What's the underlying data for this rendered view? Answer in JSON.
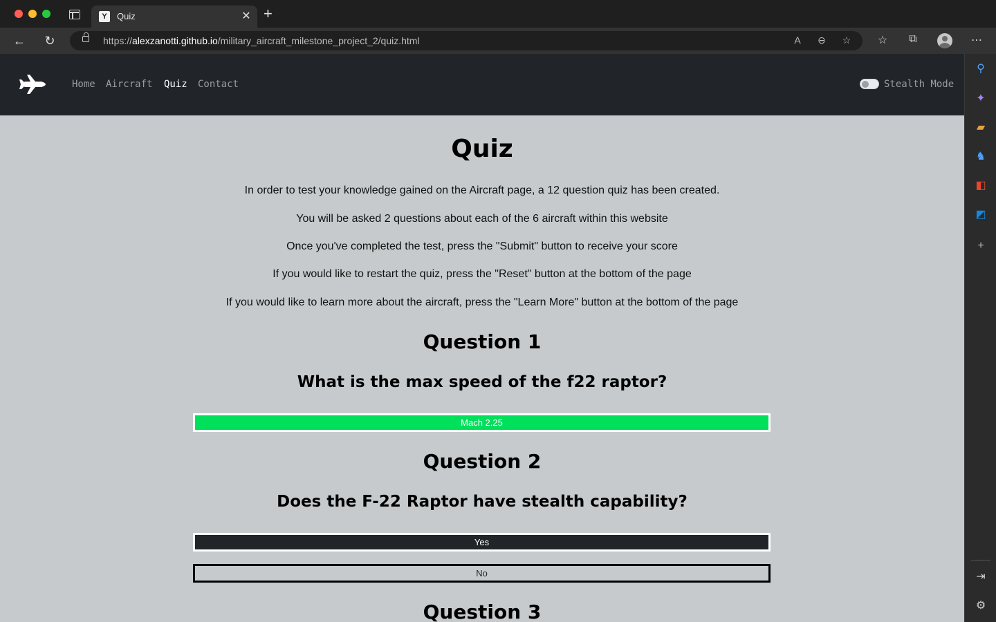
{
  "browser": {
    "tab_title": "Quiz",
    "tab_favicon": "Y",
    "url_prefix": "https://",
    "url_host": "alexzanotti.github.io",
    "url_path": "/military_aircraft_milestone_project_2/quiz.html"
  },
  "site_nav": {
    "links": [
      {
        "label": "Home"
      },
      {
        "label": "Aircraft"
      },
      {
        "label": "Quiz"
      },
      {
        "label": "Contact"
      }
    ],
    "toggle_label": "Stealth Mode"
  },
  "page": {
    "title": "Quiz",
    "intro": [
      "In order to test your knowledge gained on the Aircraft page, a 12 question quiz has been created.",
      "You will be asked 2 questions about each of the 6 aircraft within this website",
      "Once you've completed the test, press the \"Submit\" button to receive your score",
      "If you would like to restart the quiz, press the \"Reset\" button at the bottom of the page",
      "If you would like to learn more about the aircraft, press the \"Learn More\" button at the bottom of the page"
    ],
    "questions": [
      {
        "heading": "Question 1",
        "text": "What is the max speed of the f22 raptor?",
        "answers": [
          {
            "label": "Mach 2.25",
            "state": "correct"
          }
        ]
      },
      {
        "heading": "Question 2",
        "text": "Does the F-22 Raptor have stealth capability?",
        "answers": [
          {
            "label": "Yes",
            "state": "selected"
          },
          {
            "label": "No",
            "state": "unselected"
          }
        ]
      },
      {
        "heading": "Question 3"
      }
    ]
  },
  "colors": {
    "correct": "#00e05a",
    "navbar": "#212529",
    "page_bg": "#c6cacd"
  }
}
